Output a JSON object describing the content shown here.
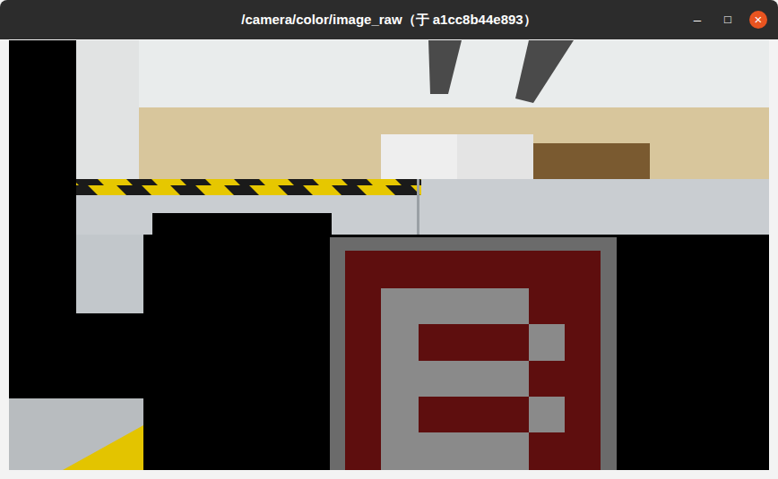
{
  "window": {
    "title": "/camera/color/image_raw（于 a1cc8b44e893）",
    "controls": {
      "minimize": "–",
      "maximize": "□",
      "close": "×"
    }
  }
}
